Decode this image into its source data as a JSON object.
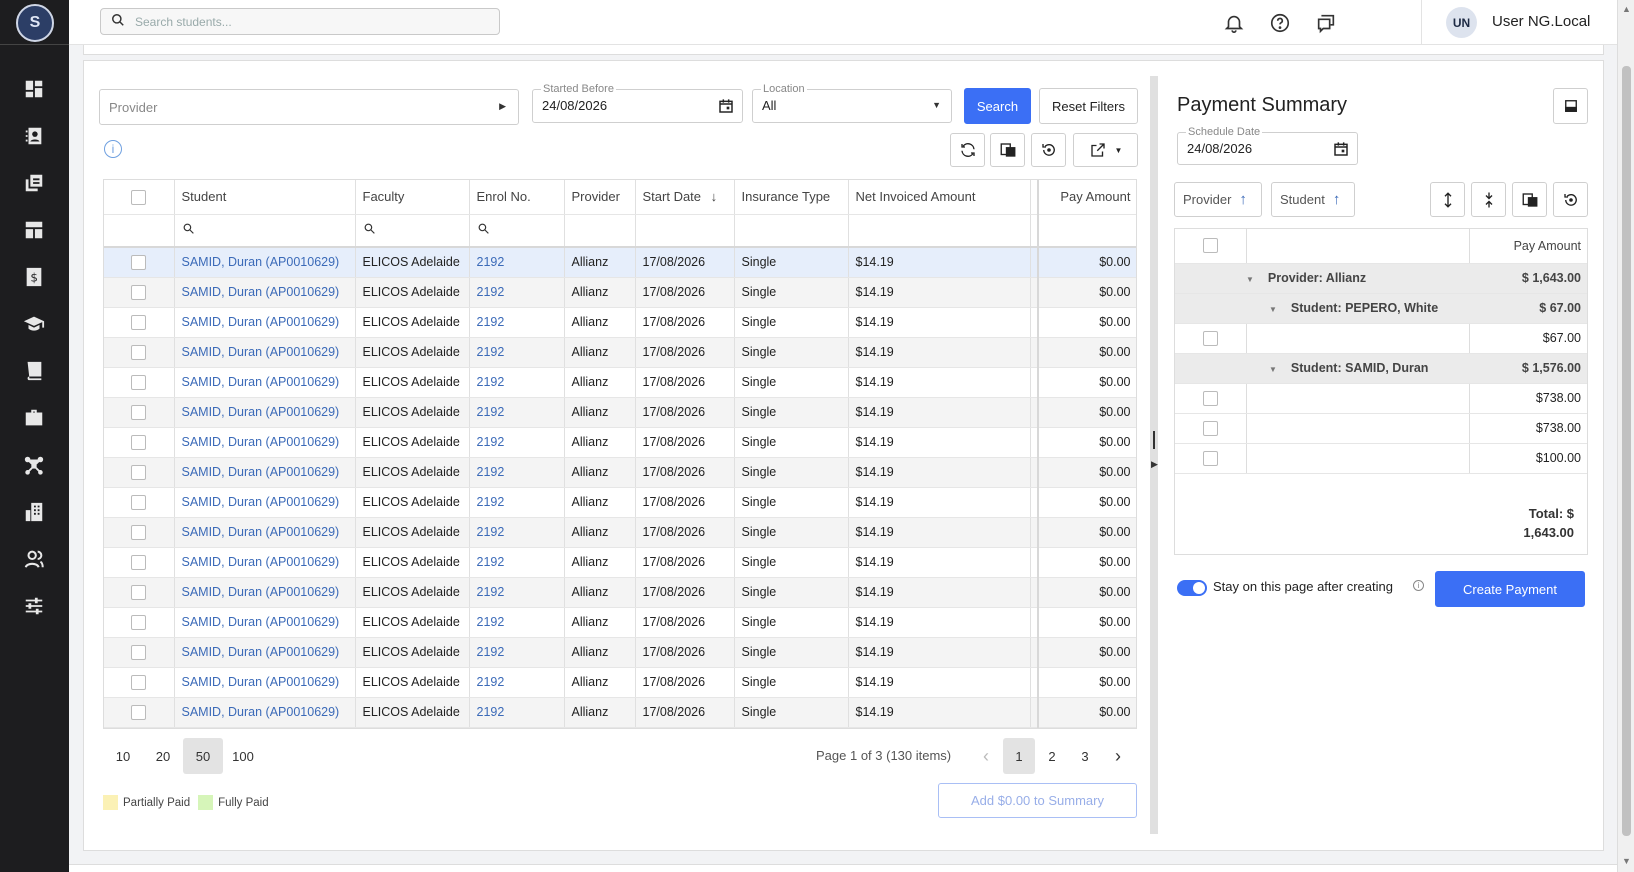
{
  "app": {
    "logo_letter": "S"
  },
  "topbar": {
    "search_placeholder": "Search students...",
    "avatar_initials": "UN",
    "username": "User NG.Local"
  },
  "sidebar": {
    "items": [
      {
        "icon": "dashboard-icon"
      },
      {
        "icon": "contacts-icon"
      },
      {
        "icon": "documents-icon"
      },
      {
        "icon": "layout-icon"
      },
      {
        "icon": "invoice-icon"
      },
      {
        "icon": "graduation-cap-icon"
      },
      {
        "icon": "book-icon"
      },
      {
        "icon": "briefcase-icon"
      },
      {
        "icon": "network-icon"
      },
      {
        "icon": "building-icon"
      },
      {
        "icon": "users-icon"
      },
      {
        "icon": "sliders-icon"
      }
    ]
  },
  "filters": {
    "provider_placeholder": "Provider",
    "started_before_label": "Started Before",
    "started_before_value": "24/08/2026",
    "location_label": "Location",
    "location_value": "All",
    "search_label": "Search",
    "reset_label": "Reset Filters"
  },
  "grid": {
    "columns": [
      "Student",
      "Faculty",
      "Enrol No.",
      "Provider",
      "Start Date",
      "Insurance Type",
      "Net Invoiced Amount",
      "Pay Amount"
    ],
    "rows": [
      {
        "student": "SAMID, Duran (AP0010629)",
        "faculty": "ELICOS Adelaide",
        "enrol": "2192",
        "provider": "Allianz",
        "start": "17/08/2026",
        "insurance": "Single",
        "net": "$14.19",
        "pay": "$0.00"
      },
      {
        "student": "SAMID, Duran (AP0010629)",
        "faculty": "ELICOS Adelaide",
        "enrol": "2192",
        "provider": "Allianz",
        "start": "17/08/2026",
        "insurance": "Single",
        "net": "$14.19",
        "pay": "$0.00"
      },
      {
        "student": "SAMID, Duran (AP0010629)",
        "faculty": "ELICOS Adelaide",
        "enrol": "2192",
        "provider": "Allianz",
        "start": "17/08/2026",
        "insurance": "Single",
        "net": "$14.19",
        "pay": "$0.00"
      },
      {
        "student": "SAMID, Duran (AP0010629)",
        "faculty": "ELICOS Adelaide",
        "enrol": "2192",
        "provider": "Allianz",
        "start": "17/08/2026",
        "insurance": "Single",
        "net": "$14.19",
        "pay": "$0.00"
      },
      {
        "student": "SAMID, Duran (AP0010629)",
        "faculty": "ELICOS Adelaide",
        "enrol": "2192",
        "provider": "Allianz",
        "start": "17/08/2026",
        "insurance": "Single",
        "net": "$14.19",
        "pay": "$0.00"
      },
      {
        "student": "SAMID, Duran (AP0010629)",
        "faculty": "ELICOS Adelaide",
        "enrol": "2192",
        "provider": "Allianz",
        "start": "17/08/2026",
        "insurance": "Single",
        "net": "$14.19",
        "pay": "$0.00"
      },
      {
        "student": "SAMID, Duran (AP0010629)",
        "faculty": "ELICOS Adelaide",
        "enrol": "2192",
        "provider": "Allianz",
        "start": "17/08/2026",
        "insurance": "Single",
        "net": "$14.19",
        "pay": "$0.00"
      },
      {
        "student": "SAMID, Duran (AP0010629)",
        "faculty": "ELICOS Adelaide",
        "enrol": "2192",
        "provider": "Allianz",
        "start": "17/08/2026",
        "insurance": "Single",
        "net": "$14.19",
        "pay": "$0.00"
      },
      {
        "student": "SAMID, Duran (AP0010629)",
        "faculty": "ELICOS Adelaide",
        "enrol": "2192",
        "provider": "Allianz",
        "start": "17/08/2026",
        "insurance": "Single",
        "net": "$14.19",
        "pay": "$0.00"
      },
      {
        "student": "SAMID, Duran (AP0010629)",
        "faculty": "ELICOS Adelaide",
        "enrol": "2192",
        "provider": "Allianz",
        "start": "17/08/2026",
        "insurance": "Single",
        "net": "$14.19",
        "pay": "$0.00"
      },
      {
        "student": "SAMID, Duran (AP0010629)",
        "faculty": "ELICOS Adelaide",
        "enrol": "2192",
        "provider": "Allianz",
        "start": "17/08/2026",
        "insurance": "Single",
        "net": "$14.19",
        "pay": "$0.00"
      },
      {
        "student": "SAMID, Duran (AP0010629)",
        "faculty": "ELICOS Adelaide",
        "enrol": "2192",
        "provider": "Allianz",
        "start": "17/08/2026",
        "insurance": "Single",
        "net": "$14.19",
        "pay": "$0.00"
      },
      {
        "student": "SAMID, Duran (AP0010629)",
        "faculty": "ELICOS Adelaide",
        "enrol": "2192",
        "provider": "Allianz",
        "start": "17/08/2026",
        "insurance": "Single",
        "net": "$14.19",
        "pay": "$0.00"
      },
      {
        "student": "SAMID, Duran (AP0010629)",
        "faculty": "ELICOS Adelaide",
        "enrol": "2192",
        "provider": "Allianz",
        "start": "17/08/2026",
        "insurance": "Single",
        "net": "$14.19",
        "pay": "$0.00"
      },
      {
        "student": "SAMID, Duran (AP0010629)",
        "faculty": "ELICOS Adelaide",
        "enrol": "2192",
        "provider": "Allianz",
        "start": "17/08/2026",
        "insurance": "Single",
        "net": "$14.19",
        "pay": "$0.00"
      },
      {
        "student": "SAMID, Duran (AP0010629)",
        "faculty": "ELICOS Adelaide",
        "enrol": "2192",
        "provider": "Allianz",
        "start": "17/08/2026",
        "insurance": "Single",
        "net": "$14.19",
        "pay": "$0.00"
      }
    ]
  },
  "pager": {
    "sizes": [
      "10",
      "20",
      "50",
      "100"
    ],
    "active_size": "50",
    "info": "Page 1 of 3 (130 items)",
    "pages": [
      "1",
      "2",
      "3"
    ],
    "active_page": "1"
  },
  "legend": {
    "partial_label": "Partially Paid",
    "partial_color": "#fbf1b5",
    "full_label": "Fully Paid",
    "full_color": "#d6f5b9"
  },
  "add_button_label": "Add $0.00 to Summary",
  "summary": {
    "title": "Payment Summary",
    "schedule_label": "Schedule Date",
    "schedule_value": "24/08/2026",
    "group_chips": [
      "Provider",
      "Student"
    ],
    "pay_amount_header": "Pay Amount",
    "rows": [
      {
        "type": "group1",
        "label": "Provider: Allianz",
        "amount": "$ 1,643.00"
      },
      {
        "type": "group2",
        "label": "Student: PEPERO, White",
        "amount": "$ 67.00"
      },
      {
        "type": "item",
        "amount": "$67.00"
      },
      {
        "type": "group2",
        "label": "Student: SAMID, Duran",
        "amount": "$ 1,576.00"
      },
      {
        "type": "item",
        "amount": "$738.00"
      },
      {
        "type": "item",
        "amount": "$738.00"
      },
      {
        "type": "item",
        "amount": "$100.00"
      }
    ],
    "total_line1": "Total: $",
    "total_line2": "1,643.00",
    "stay_label": "Stay on this page after creating",
    "create_label": "Create Payment"
  },
  "colors": {
    "accent": "#3b6ff5",
    "link": "#3b6ab8",
    "sidebar": "#1d1d1f"
  }
}
